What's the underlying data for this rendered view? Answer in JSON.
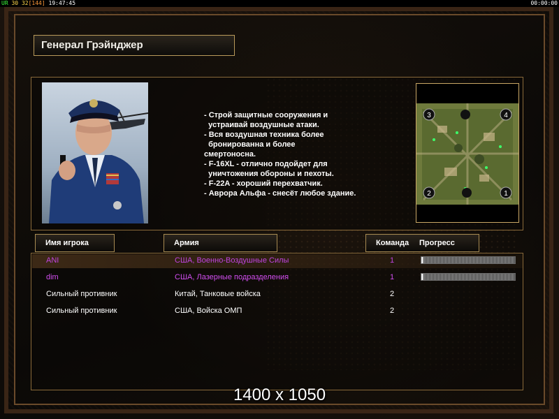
{
  "topbar": {
    "ur": "UR",
    "fps": "30",
    "net": "32",
    "lag": "[144]",
    "time_left": "19:47:45",
    "time_right": "00:00:00"
  },
  "general": {
    "name": "Генерал Грэйнджер",
    "description": [
      "- Строй защитные сооружения и",
      "  устраивай воздушные атаки.",
      "- Вся воздушная техника более",
      "  бронированна и более",
      "смертоносна.",
      "- F-16XL - отлично подойдет для",
      "  уничтожения обороны и пехоты.",
      "- F-22A - хороший перехватчик.",
      "- Аврора Альфа - снесёт любое здание."
    ]
  },
  "map": {
    "spawn_labels": [
      "3",
      "4",
      "2",
      "1"
    ]
  },
  "columns": {
    "player": "Имя игрока",
    "army": "Армия",
    "team": "Команда",
    "progress": "Прогресс"
  },
  "players": [
    {
      "name": "ANI",
      "army": "США, Военно-Воздушные Силы",
      "team": "1",
      "color": "#c044e0",
      "has_progress": true,
      "progress": 0.02
    },
    {
      "name": "dim",
      "army": "США, Лазерные подразделения",
      "team": "1",
      "color": "#d24ef0",
      "has_progress": true,
      "progress": 0.02
    },
    {
      "name": "Сильный противник",
      "army": "Китай, Танковые войска",
      "team": "2",
      "color": "#ffffff",
      "has_progress": false
    },
    {
      "name": "Сильный противник",
      "army": "США, Войска ОМП",
      "team": "2",
      "color": "#ffffff",
      "has_progress": false
    }
  ],
  "overlay": {
    "resolution": "1400 x 1050"
  }
}
